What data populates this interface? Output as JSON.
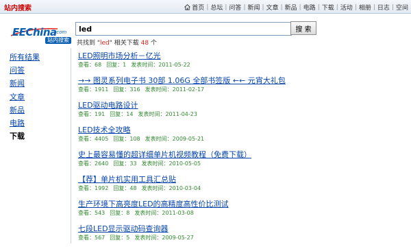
{
  "header": {
    "title": "站内搜索",
    "nav": [
      "首页",
      "总坛",
      "问答",
      "新闻",
      "文章",
      "新品",
      "电路",
      "下载",
      "活动",
      "相册",
      "日志",
      "空间"
    ]
  },
  "logo": {
    "brand": "EEChina",
    "domain": ".com",
    "subtitle": "站内搜索"
  },
  "search": {
    "value": "led",
    "button_label": "搜 索"
  },
  "summary": {
    "prefix": "共找到 \"",
    "keyword": "led",
    "middle": "\" 相关下载 ",
    "count": "48",
    "suffix": " 个"
  },
  "sidebar": {
    "items": [
      {
        "label": "所有结果",
        "active": false
      },
      {
        "label": "问答",
        "active": false
      },
      {
        "label": "新闻",
        "active": false
      },
      {
        "label": "文章",
        "active": false
      },
      {
        "label": "新品",
        "active": false
      },
      {
        "label": "电路",
        "active": false
      },
      {
        "label": "下载",
        "active": true
      }
    ]
  },
  "results": [
    {
      "title": "LED照明市场分析－亿光",
      "views": "查看：68",
      "replies": "回复：1",
      "date": "发表时间：2011-05-22"
    },
    {
      "title": "→→ 图灵系列电子书 30部 1.06G 全部书签版 ←← 元宵大礼包",
      "views": "查看：1911",
      "replies": "回复：316",
      "date": "发表时间：2011-02-17"
    },
    {
      "title": "LED驱动电路设计",
      "views": "查看：191",
      "replies": "回复：14",
      "date": "发表时间：2011-04-23"
    },
    {
      "title": "LED技术全攻略",
      "views": "查看：4405",
      "replies": "回复：108",
      "date": "发表时间：2009-05-21"
    },
    {
      "title": "史上最容易懂的超详细单片机视频教程（免费下载）",
      "views": "查看：2640",
      "replies": "回复：33",
      "date": "发表时间：2010-05-05"
    },
    {
      "title": "【荐】单片机实用工具汇总贴",
      "views": "查看：1992",
      "replies": "回复：48",
      "date": "发表时间：2010-03-04"
    },
    {
      "title": "生产环境下高亮度LED的高精度高性价比测试",
      "views": "查看：543",
      "replies": "回复：8",
      "date": "发表时间：2011-03-08"
    },
    {
      "title": "七段LED显示驱动码查询器",
      "views": "查看：567",
      "replies": "回复：5",
      "date": "发表时间：2009-05-27"
    }
  ],
  "colors": {
    "accent_red": "#e2231a",
    "link_blue": "#0645ad",
    "meta_green": "#2f8a2f",
    "brand_blue": "#0a5fb0"
  }
}
